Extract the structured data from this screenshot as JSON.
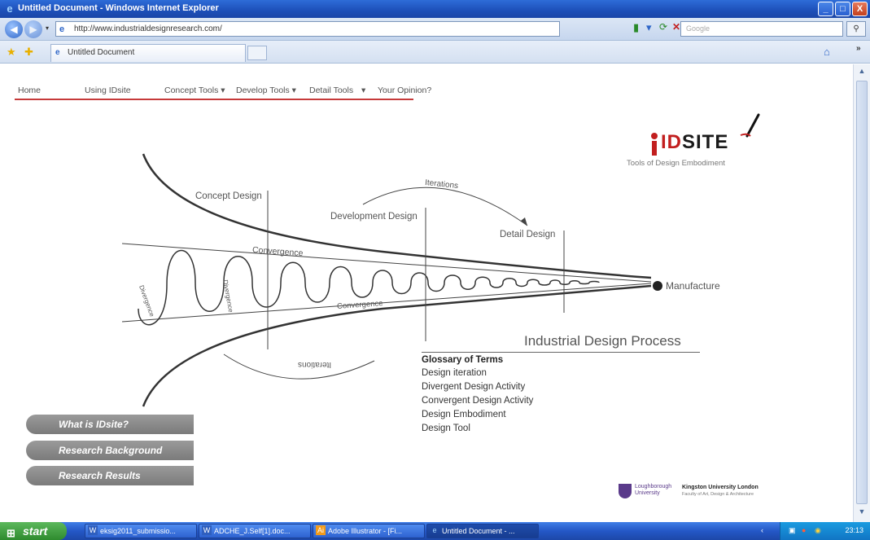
{
  "window": {
    "title": "Untitled Document - Windows Internet Explorer",
    "minimize": "_",
    "maximize": "□",
    "close": "X"
  },
  "address_bar": {
    "url": "http://www.industrialdesignresearch.com/",
    "search_placeholder": "Google"
  },
  "tabs": [
    {
      "label": "Untitled Document"
    }
  ],
  "site_nav": {
    "items": [
      {
        "label": "Home"
      },
      {
        "label": "Using IDsite"
      },
      {
        "label": "Concept Tools ▾"
      },
      {
        "label": "Develop Tools ▾"
      },
      {
        "label": "Detail Tools"
      },
      {
        "label": "▾"
      },
      {
        "label": "Your Opinion?"
      }
    ]
  },
  "logo": {
    "brand_prefix": "ID",
    "brand_suffix": "SITE",
    "subtitle": "Tools of Design Embodiment"
  },
  "diagram": {
    "concept_design": "Concept Design",
    "development_design": "Development Design",
    "detail_design": "Detail Design",
    "iterations_top": "Iterations",
    "iterations_bottom": "Iterations",
    "convergence_top": "Convergence",
    "convergence_bottom": "Convergence",
    "divergence_left": "Divergence",
    "divergence_right": "Divergence",
    "manufacture": "Manufacture",
    "process_title": "Industrial Design Process"
  },
  "glossary": {
    "title": "Glossary of Terms",
    "terms": [
      "Design iteration",
      "Divergent Design Activity",
      "Convergent Design Activity",
      "Design Embodiment",
      "Design Tool"
    ]
  },
  "side_buttons": [
    {
      "label": "What is IDsite?"
    },
    {
      "label": "Research Background"
    },
    {
      "label": "Research Results"
    }
  ],
  "footer": {
    "loughborough_line1": "Loughborough",
    "loughborough_line2": "University",
    "kingston": "Kingston University London",
    "kingston_sub": "Faculty of Art, Design & Architecture"
  },
  "taskbar": {
    "start_label": "start",
    "items": [
      {
        "label": "eksig2011_submissio..."
      },
      {
        "label": "ADCHE_J.Self[1].doc..."
      },
      {
        "label": "Adobe Illustrator - [Fi..."
      },
      {
        "label": "Untitled Document - ..."
      }
    ],
    "clock": "23:13"
  },
  "colors": {
    "accent_red": "#c63a3a",
    "titlebar_blue": "#2457c6",
    "button_grey": "#8a8a8a"
  }
}
